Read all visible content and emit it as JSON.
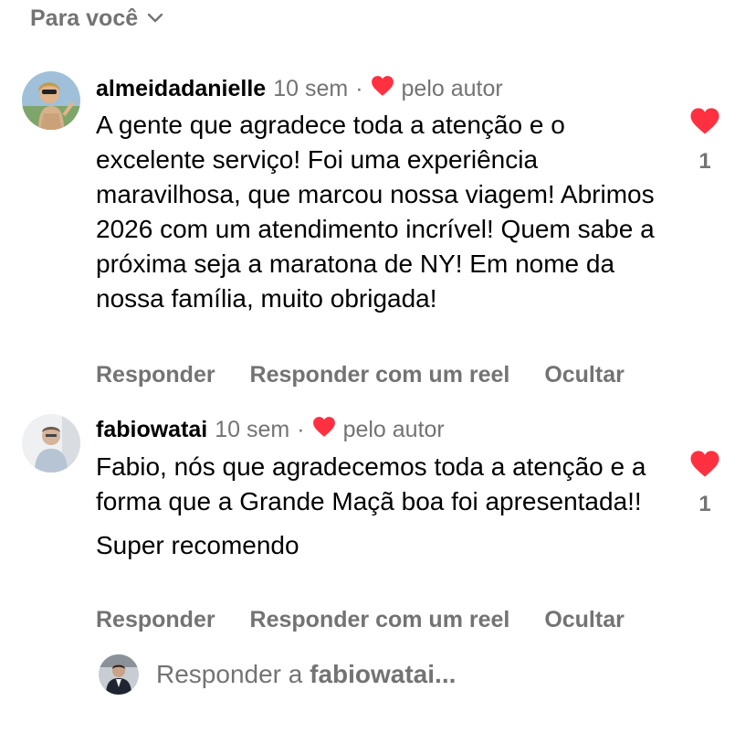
{
  "filter": {
    "label": "Para você"
  },
  "comments": [
    {
      "username": "almeidadanielle",
      "time": "10 sem",
      "separator": "·",
      "liked_by_author": "pelo autor",
      "text": "A gente que agradece toda a atenção e o excelente serviço! Foi uma experiência maravilhosa, que marcou nossa viagem! Abrimos 2026 com um atendimento incrível! Quem sabe a próxima seja a maratona de NY! Em nome da nossa família, muito obrigada!",
      "likes": "1",
      "actions": [
        "Responder",
        "Responder com um reel",
        "Ocultar"
      ]
    },
    {
      "username": "fabiowatai",
      "time": "10 sem",
      "separator": "·",
      "liked_by_author": "pelo autor",
      "text_lines": [
        "Fabio, nós que agradecemos toda a atenção e a forma que a Grande Maçã boa foi apresentada!!",
        "Super recomendo"
      ],
      "likes": "1",
      "actions": [
        "Responder",
        "Responder com um reel",
        "Ocultar"
      ]
    }
  ],
  "reply": {
    "prefix": "Responder a",
    "target": "fabiowatai..."
  },
  "colors": {
    "heart": "#ff3040",
    "muted": "#737373",
    "text": "#000000"
  },
  "icons": {
    "filter_chevron": "chevron-down-icon",
    "like": "heart-icon",
    "author_like": "small-heart-icon"
  }
}
